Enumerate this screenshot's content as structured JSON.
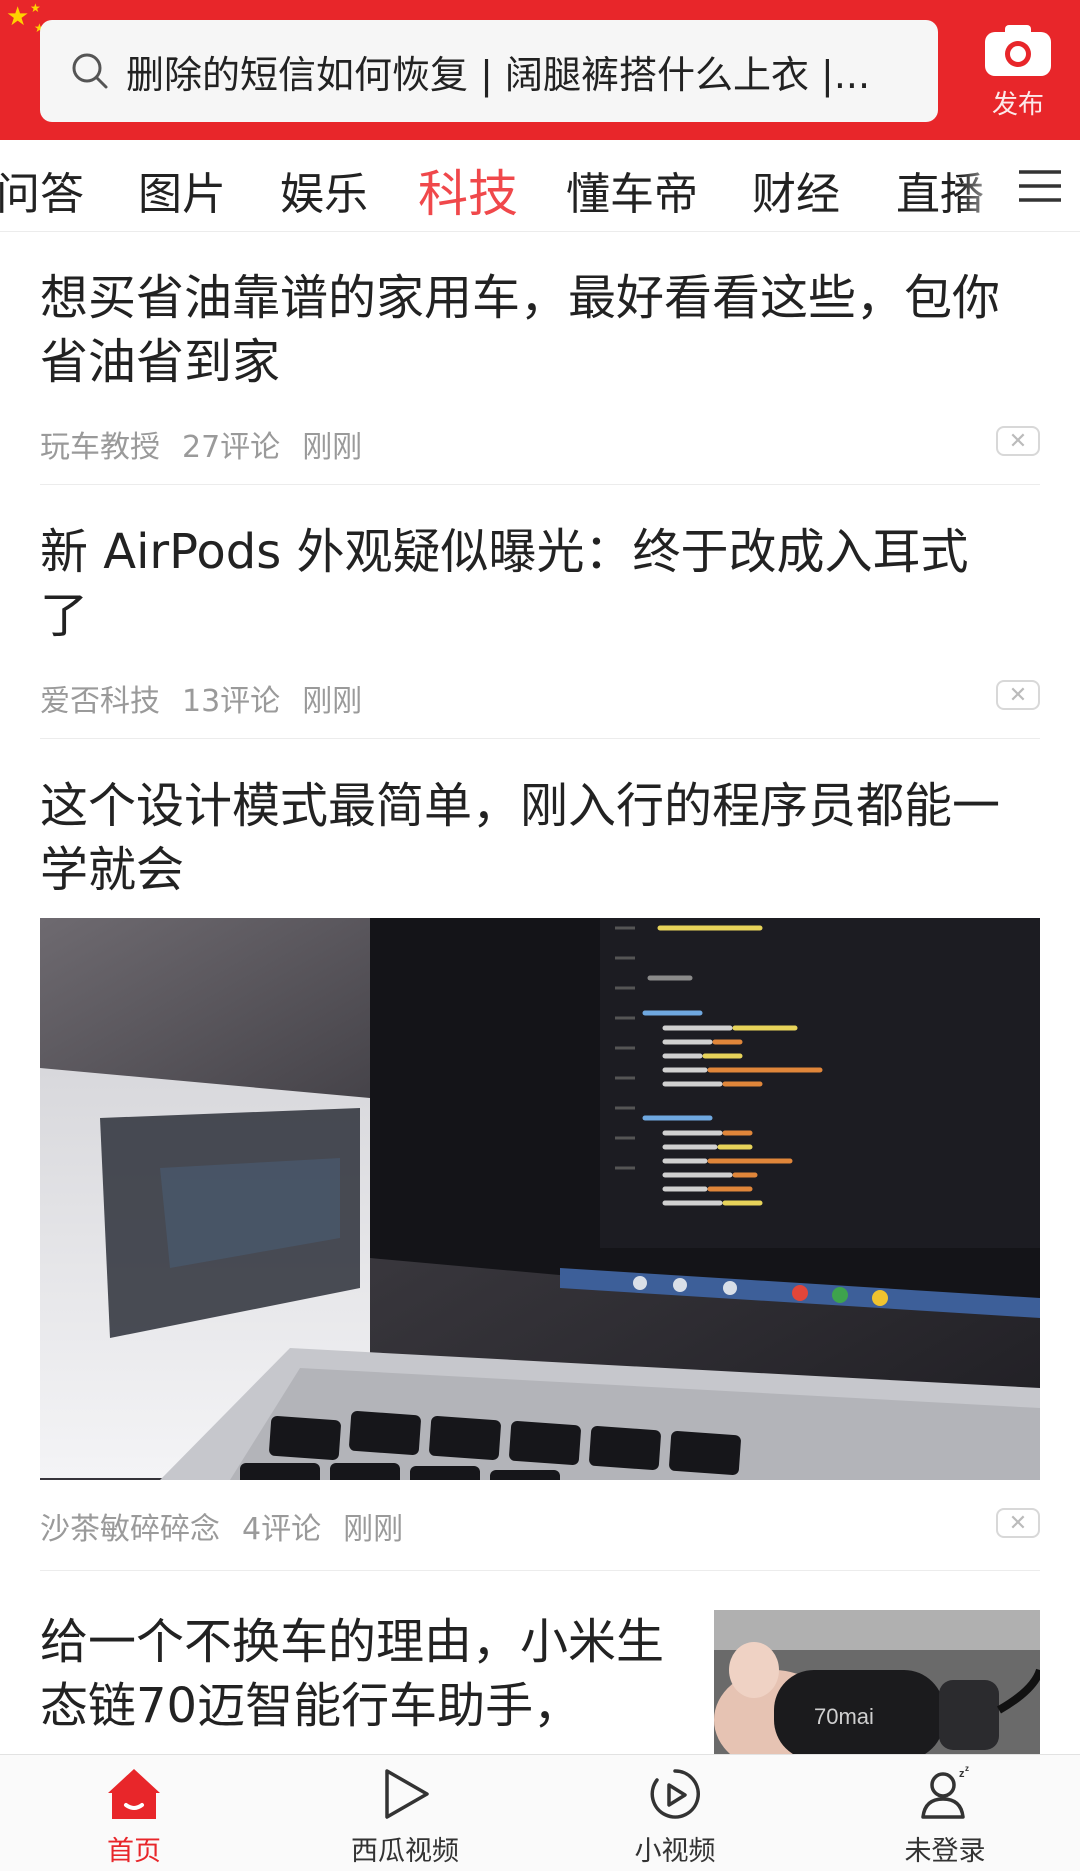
{
  "header": {
    "search_placeholder": "删除的短信如何恢复 | 阔腿裤搭什么上衣 |...",
    "publish_label": "发布",
    "colors": {
      "brand_red": "#e8262a",
      "active_tab": "#f0484b"
    }
  },
  "tabs": [
    {
      "label": "问答"
    },
    {
      "label": "图片"
    },
    {
      "label": "娱乐"
    },
    {
      "label": "科技",
      "active": true
    },
    {
      "label": "懂车帝"
    },
    {
      "label": "财经"
    },
    {
      "label": "直播"
    }
  ],
  "articles": [
    {
      "title": "想买省油靠谱的家用车，最好看看这些，包你省油省到家",
      "source": "玩车教授",
      "comments": "27评论",
      "time": "刚刚"
    },
    {
      "title": "新 AirPods 外观疑似曝光：终于改成入耳式了",
      "source": "爱否科技",
      "comments": "13评论",
      "time": "刚刚"
    },
    {
      "title": "这个设计模式最简单，刚入行的程序员都能一学就会",
      "source": "沙茶敏碎碎念",
      "comments": "4评论",
      "time": "刚刚",
      "image": "laptop-code-image"
    },
    {
      "title": "给一个不换车的理由，小米生态链70迈智能行车助手，",
      "thumb_text": "70mai"
    }
  ],
  "bottom_nav": [
    {
      "label": "首页",
      "icon": "home-icon",
      "active": true
    },
    {
      "label": "西瓜视频",
      "icon": "play-icon"
    },
    {
      "label": "小视频",
      "icon": "small-video-icon"
    },
    {
      "label": "未登录",
      "icon": "user-icon"
    }
  ]
}
